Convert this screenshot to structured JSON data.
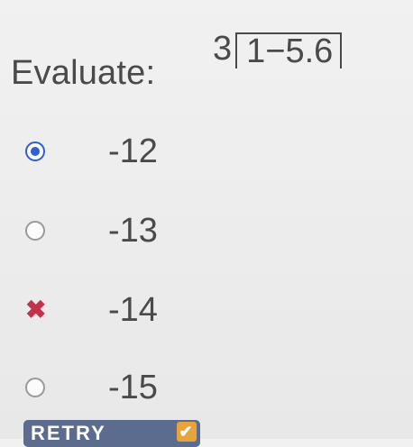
{
  "question": {
    "prompt": "Evaluate:",
    "coefficient": "3",
    "expression_inner": "1−5.6"
  },
  "options": [
    {
      "label": "-12",
      "state": "selected"
    },
    {
      "label": "-13",
      "state": "unselected"
    },
    {
      "label": "-14",
      "state": "incorrect"
    },
    {
      "label": "-15",
      "state": "unselected"
    }
  ],
  "retry_button": {
    "label": "RETRY",
    "icon": "check-icon"
  },
  "colors": {
    "selected": "#2f5fd0",
    "incorrect": "#c2324a",
    "retry_bg": "#5b6c8e",
    "retry_icon_bg": "#e8a33c"
  }
}
